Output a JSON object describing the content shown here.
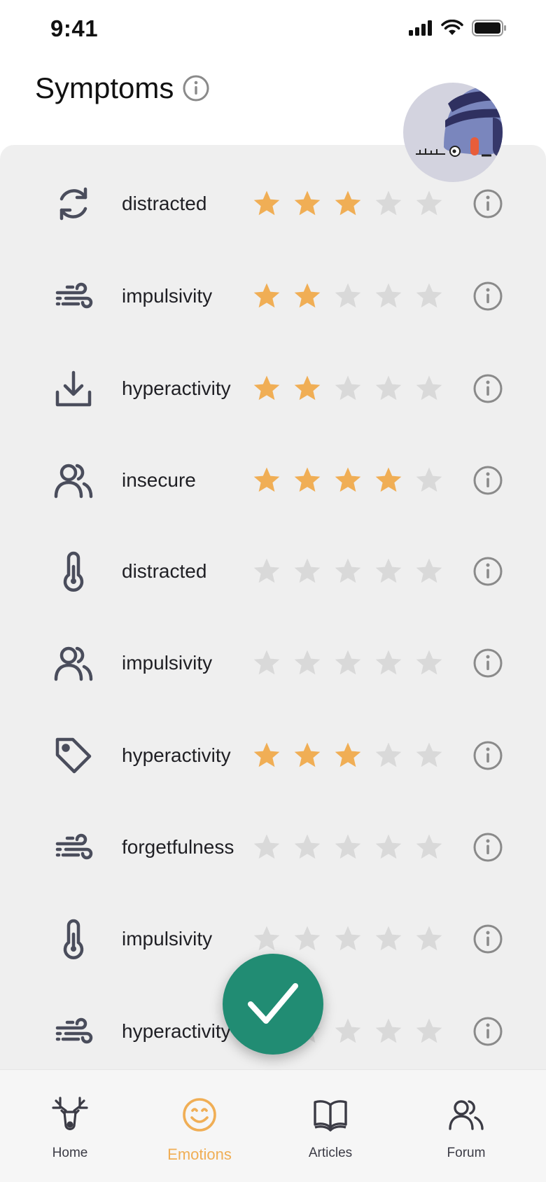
{
  "status_bar": {
    "time": "9:41"
  },
  "header": {
    "title": "Symptoms"
  },
  "colors": {
    "star_filled": "#f0ae55",
    "star_empty": "#d9d9d9",
    "fab": "#218c73",
    "active_tab": "#f0ae55",
    "icon": "#4a4d5c"
  },
  "symptoms": [
    {
      "icon": "refresh-icon",
      "label": "distracted",
      "rating": 3
    },
    {
      "icon": "wind-icon",
      "label": "impulsivity",
      "rating": 2
    },
    {
      "icon": "download-icon",
      "label": "hyperactivity",
      "rating": 2
    },
    {
      "icon": "users-icon",
      "label": "insecure",
      "rating": 4
    },
    {
      "icon": "thermometer-icon",
      "label": "distracted",
      "rating": 0
    },
    {
      "icon": "users-icon",
      "label": "impulsivity",
      "rating": 0
    },
    {
      "icon": "tag-icon",
      "label": "hyperactivity",
      "rating": 3
    },
    {
      "icon": "wind-icon",
      "label": "forgetfulness",
      "rating": 0
    },
    {
      "icon": "thermometer-icon",
      "label": "impulsivity",
      "rating": 0
    },
    {
      "icon": "wind-icon",
      "label": "hyperactivity",
      "rating": 0
    }
  ],
  "fab": {
    "icon": "check-icon"
  },
  "bottom_nav": [
    {
      "icon": "deer-icon",
      "label": "Home",
      "active": false
    },
    {
      "icon": "smile-icon",
      "label": "Emotions",
      "active": true
    },
    {
      "icon": "book-icon",
      "label": "Articles",
      "active": false
    },
    {
      "icon": "users-icon",
      "label": "Forum",
      "active": false
    }
  ]
}
